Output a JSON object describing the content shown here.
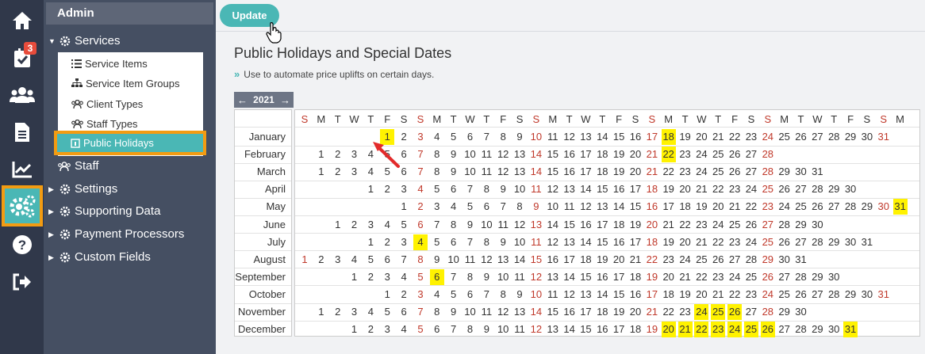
{
  "iconbar": {
    "items": [
      {
        "name": "home-icon",
        "badge": null,
        "active": false
      },
      {
        "name": "tasks-icon",
        "badge": "3",
        "active": false
      },
      {
        "name": "users-icon",
        "badge": null,
        "active": false
      },
      {
        "name": "document-icon",
        "badge": null,
        "active": false
      },
      {
        "name": "chart-icon",
        "badge": null,
        "active": false
      },
      {
        "name": "settings-gears-icon",
        "badge": null,
        "active": true
      },
      {
        "name": "help-icon",
        "badge": null,
        "active": false
      },
      {
        "name": "logout-icon",
        "badge": null,
        "active": false
      }
    ]
  },
  "sidebar": {
    "title": "Admin",
    "services_label": "Services",
    "services_submenu": [
      {
        "label": "Service Items",
        "icon": "list-icon"
      },
      {
        "label": "Service Item Groups",
        "icon": "sitemap-icon"
      },
      {
        "label": "Client Types",
        "icon": "users-icon"
      },
      {
        "label": "Staff Types",
        "icon": "users-icon"
      },
      {
        "label": "Public Holidays",
        "icon": "calendar-icon",
        "active": true
      }
    ],
    "staff_label": "Staff",
    "settings_label": "Settings",
    "supporting_data_label": "Supporting Data",
    "payment_processors_label": "Payment Processors",
    "custom_fields_label": "Custom Fields"
  },
  "toolbar": {
    "update_label": "Update"
  },
  "page": {
    "title": "Public Holidays and Special Dates",
    "subtitle_chevrons": "»",
    "subtitle": "Use to automate price uplifts on certain days."
  },
  "calendar": {
    "year": "2021",
    "prev_arrow": "←",
    "next_arrow": "→",
    "weekday_headers": [
      "S",
      "M",
      "T",
      "W",
      "T",
      "F",
      "S",
      "S",
      "M",
      "T",
      "W",
      "T",
      "F",
      "S",
      "S",
      "M",
      "T",
      "W",
      "T",
      "F",
      "S",
      "S",
      "M",
      "T",
      "W",
      "T",
      "F",
      "S",
      "S",
      "M",
      "T",
      "W",
      "T",
      "F",
      "S",
      "S",
      "M"
    ],
    "months": [
      {
        "name": "January",
        "start": 5,
        "days": 31,
        "highlighted": [
          1,
          18
        ]
      },
      {
        "name": "February",
        "start": 1,
        "days": 28,
        "highlighted": [
          22
        ]
      },
      {
        "name": "March",
        "start": 1,
        "days": 31,
        "highlighted": []
      },
      {
        "name": "April",
        "start": 4,
        "days": 30,
        "highlighted": []
      },
      {
        "name": "May",
        "start": 6,
        "days": 31,
        "highlighted": [
          31
        ]
      },
      {
        "name": "June",
        "start": 2,
        "days": 30,
        "highlighted": []
      },
      {
        "name": "July",
        "start": 4,
        "days": 31,
        "highlighted": [
          4
        ]
      },
      {
        "name": "August",
        "start": 0,
        "days": 31,
        "highlighted": []
      },
      {
        "name": "September",
        "start": 3,
        "days": 30,
        "highlighted": [
          6
        ]
      },
      {
        "name": "October",
        "start": 5,
        "days": 31,
        "highlighted": []
      },
      {
        "name": "November",
        "start": 1,
        "days": 30,
        "highlighted": [
          24,
          25,
          26
        ]
      },
      {
        "name": "December",
        "start": 3,
        "days": 31,
        "highlighted": [
          20,
          21,
          22,
          23,
          24,
          25,
          26,
          31
        ]
      }
    ]
  },
  "colors": {
    "accent": "#4ab7b5",
    "highlight": "#fff200",
    "sunday": "#c0392b",
    "focus_outline": "#f39c12"
  }
}
